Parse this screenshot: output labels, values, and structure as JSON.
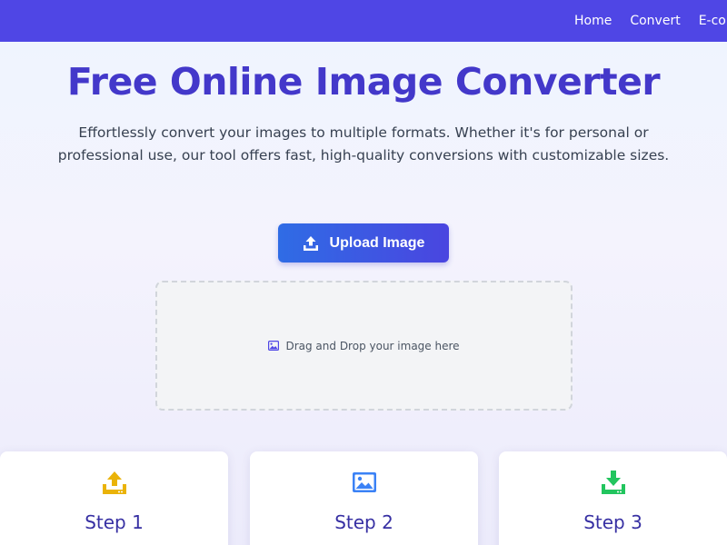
{
  "nav": {
    "links": [
      "Home",
      "Convert",
      "E-commerce"
    ]
  },
  "hero": {
    "title": "Free Online Image Converter",
    "subtitle": "Effortlessly convert your images to multiple formats. Whether it's for personal or professional use, our tool offers fast, high-quality conversions with customizable sizes."
  },
  "upload": {
    "button_label": "Upload Image",
    "button_icon": "upload-icon",
    "dropzone_text": "Drag and Drop your image here",
    "dropzone_icon": "image-icon"
  },
  "steps": [
    {
      "title": "Step 1",
      "icon": "upload-tray-icon",
      "icon_color": "#eab308"
    },
    {
      "title": "Step 2",
      "icon": "image-icon",
      "icon_color": "#3b82f6"
    },
    {
      "title": "Step 3",
      "icon": "download-tray-icon",
      "icon_color": "#22c55e"
    }
  ],
  "colors": {
    "navbar": "#4f46e5",
    "title": "#4338ca",
    "button_gradient_start": "#2f6ce5",
    "button_gradient_end": "#4a45e0"
  }
}
